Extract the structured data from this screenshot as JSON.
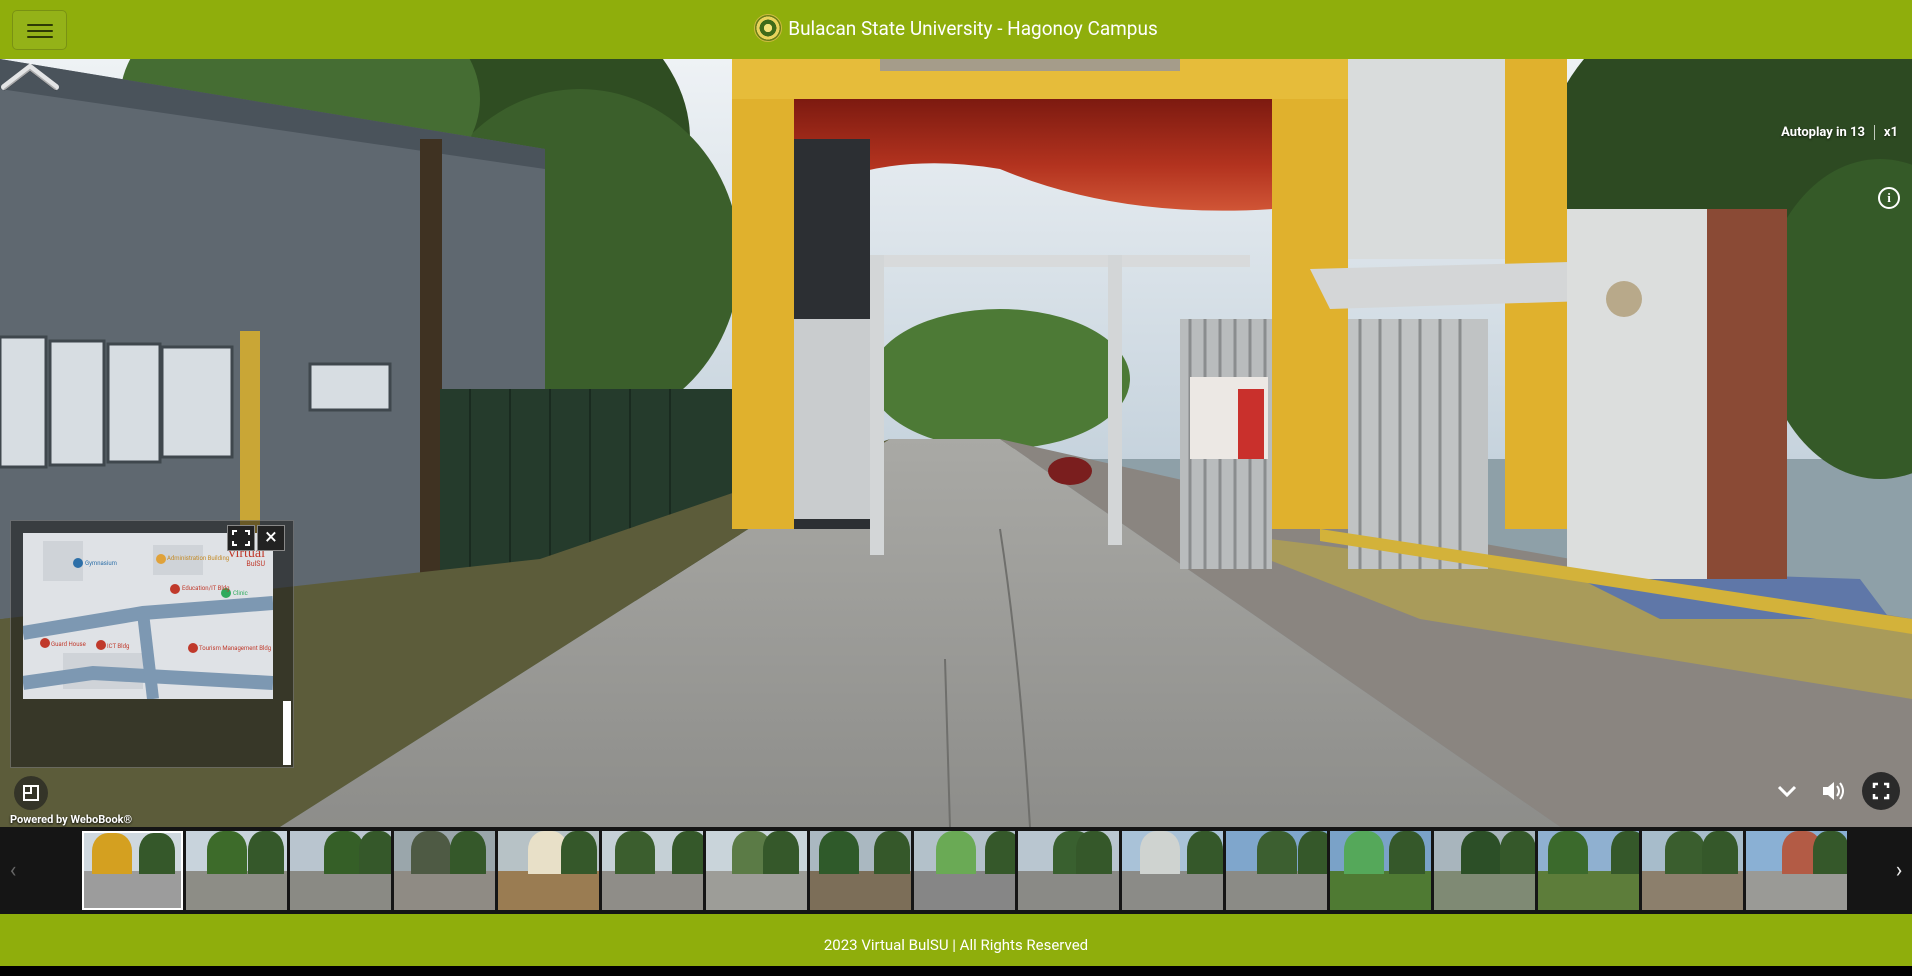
{
  "header": {
    "menu_icon": "hamburger-menu-icon",
    "logo_icon": "university-seal-icon",
    "title": "Bulacan State University - Hagonoy Campus"
  },
  "viewer": {
    "autoplay_label": "Autoplay in 13",
    "speed_label": "x1",
    "info_icon": "info-icon",
    "nav_arrow_icon": "chevron-up-icon",
    "powered_by": "Powered by WeboBook®"
  },
  "minimap": {
    "logo_line1": "virtual",
    "logo_line2": "BulSU",
    "pins": [
      "Gymnasium",
      "Administration Building",
      "Education/IT Bldg",
      "Clinic",
      "Guard House",
      "ICT Bldg",
      "Tourism Management Bldg"
    ],
    "expand_icon": "expand-icon",
    "close_icon": "close-icon"
  },
  "controls": {
    "map_toggle_icon": "map-toggle-icon",
    "collapse_icon": "chevron-down-icon",
    "sound_icon": "volume-icon",
    "fullscreen_icon": "fullscreen-icon"
  },
  "thumbnails": {
    "prev_icon": "chevron-left-icon",
    "next_icon": "chevron-right-icon",
    "count": 17,
    "active_index": 0,
    "themes": [
      {
        "sky": "#cfd8df",
        "ground": "#9c9c9c",
        "accent": "#d4a020"
      },
      {
        "sky": "#c8d3dc",
        "ground": "#8d8d86",
        "accent": "#3d6b2a"
      },
      {
        "sky": "#b9c5cf",
        "ground": "#8a8a84",
        "accent": "#355f27"
      },
      {
        "sky": "#9aa6ab",
        "ground": "#8f8b84",
        "accent": "#4e5a44"
      },
      {
        "sky": "#b7c2c6",
        "ground": "#9a7c52",
        "accent": "#e8e0c8"
      },
      {
        "sky": "#c5d0d6",
        "ground": "#8f8d88",
        "accent": "#3b5e2e"
      },
      {
        "sky": "#c9d4da",
        "ground": "#9d9d98",
        "accent": "#5b7b46"
      },
      {
        "sky": "#aab8c1",
        "ground": "#7c6e58",
        "accent": "#2f5a2a"
      },
      {
        "sky": "#b3c1ca",
        "ground": "#868686",
        "accent": "#6aaa55"
      },
      {
        "sky": "#b9c6d0",
        "ground": "#8a8a86",
        "accent": "#39602f"
      },
      {
        "sky": "#a9c2d8",
        "ground": "#8b8b87",
        "accent": "#cfd3d0"
      },
      {
        "sky": "#7fa6cc",
        "ground": "#8b8b86",
        "accent": "#3c5f30"
      },
      {
        "sky": "#7aa2c8",
        "ground": "#4f7a33",
        "accent": "#55a85a"
      },
      {
        "sky": "#a8b5bd",
        "ground": "#7f8a74",
        "accent": "#2c4f27"
      },
      {
        "sky": "#8fb0d0",
        "ground": "#5d7d3a",
        "accent": "#3b6a2c"
      },
      {
        "sky": "#a7bccb",
        "ground": "#8c7f6c",
        "accent": "#3a5e2e"
      },
      {
        "sky": "#8ab0d4",
        "ground": "#9a9a96",
        "accent": "#b35b45"
      }
    ]
  },
  "footer": {
    "text": "2023 Virtual BulSU | All Rights Reserved"
  },
  "colors": {
    "brand_green": "#8fae0c",
    "gate_yellow": "#e0b12d",
    "canopy_red": "#b3331f"
  }
}
